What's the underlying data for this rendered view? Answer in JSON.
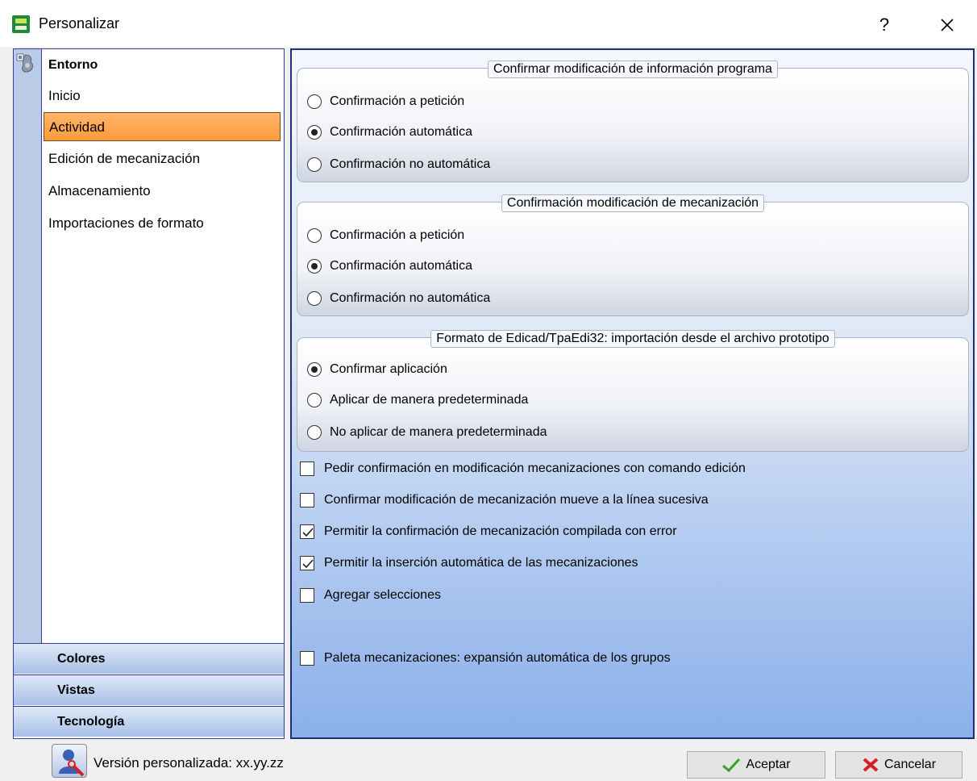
{
  "window": {
    "title": "Personalizar",
    "help_label": "?"
  },
  "sidebar": {
    "title": "Entorno",
    "items": [
      {
        "label": "Inicio",
        "active": false
      },
      {
        "label": "Actividad",
        "active": true
      },
      {
        "label": "Edición de mecanización",
        "active": false
      },
      {
        "label": "Almacenamiento",
        "active": false
      },
      {
        "label": "Importaciones de formato",
        "active": false
      }
    ],
    "sections": [
      "Colores",
      "Vistas",
      "Tecnología"
    ]
  },
  "groups": [
    {
      "title": "Confirmar modificación de información programa",
      "options": [
        "Confirmación a petición",
        "Confirmación automática",
        "Confirmación no automática"
      ],
      "selected": 1
    },
    {
      "title": "Confirmación modificación de mecanización",
      "options": [
        "Confirmación a petición",
        "Confirmación automática",
        "Confirmación no automática"
      ],
      "selected": 1
    },
    {
      "title": "Formato de Edicad/TpaEdi32: importación desde el archivo prototipo",
      "options": [
        "Confirmar aplicación",
        "Aplicar de manera predeterminada",
        "No aplicar de manera predeterminada"
      ],
      "selected": 0
    }
  ],
  "checkboxes": [
    {
      "label": "Pedir confirmación en modificación mecanizaciones con comando edición",
      "checked": false
    },
    {
      "label": "Confirmar modificación de mecanización mueve a la línea sucesiva",
      "checked": false
    },
    {
      "label": "Permitir la confirmación de mecanización compilada con error",
      "checked": true
    },
    {
      "label": "Permitir la inserción automática de las mecanizaciones",
      "checked": true
    },
    {
      "label": "Agregar selecciones",
      "checked": false
    },
    {
      "label": "Paleta mecanizaciones: expansión automática de los grupos",
      "checked": false
    }
  ],
  "footer": {
    "version": "Versión personalizada: xx.yy.zz",
    "ok_label": "Aceptar",
    "cancel_label": "Cancelar"
  },
  "colors": {
    "active_item": "#ff9a3a",
    "panel_border": "#1c2f7a",
    "accept_icon": "#3aa02a",
    "cancel_icon": "#d62020"
  },
  "icons": [
    "app-icon",
    "close-icon",
    "entorno-icon",
    "user-settings-icon",
    "checkmark-icon",
    "x-mark-icon"
  ]
}
